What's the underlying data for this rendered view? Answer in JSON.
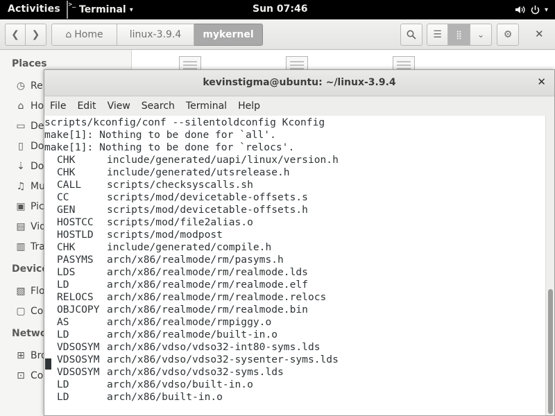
{
  "topbar": {
    "activities": "Activities",
    "app_icon_glyph": ">_",
    "app_name": "Terminal",
    "clock": "Sun 07:46",
    "volume_icon": "speaker-icon",
    "power_icon": "power-icon"
  },
  "file_manager": {
    "back_icon": "back-icon",
    "forward_icon": "forward-icon",
    "path": [
      {
        "label": "Home",
        "icon": "home-icon"
      },
      {
        "label": "linux-3.9.4"
      },
      {
        "label": "mykernel"
      }
    ],
    "search_icon": "search-icon",
    "list_view_icon": "list-view-icon",
    "grid_view_icon": "grid-view-icon",
    "view_options_icon": "chevron-down-icon",
    "settings_icon": "gear-icon",
    "close_icon": "close-icon",
    "sidebar": {
      "places_header": "Places",
      "places": [
        {
          "label": "Re",
          "icon": "recent-icon"
        },
        {
          "label": "Ho",
          "icon": "home-icon"
        },
        {
          "label": "De",
          "icon": "desktop-icon"
        },
        {
          "label": "Do",
          "icon": "documents-icon"
        },
        {
          "label": "Do",
          "icon": "downloads-icon"
        },
        {
          "label": "Mu",
          "icon": "music-icon"
        },
        {
          "label": "Pic",
          "icon": "pictures-icon"
        },
        {
          "label": "Vid",
          "icon": "videos-icon"
        },
        {
          "label": "Tra",
          "icon": "trash-icon"
        }
      ],
      "devices_header": "Device",
      "devices": [
        {
          "label": "Flo",
          "icon": "floppy-icon"
        },
        {
          "label": "Co",
          "icon": "computer-icon"
        }
      ],
      "network_header": "Netwo",
      "network": [
        {
          "label": "Bro",
          "icon": "network-icon"
        },
        {
          "label": "Co",
          "icon": "connect-icon"
        }
      ]
    }
  },
  "terminal": {
    "title": "kevinstigma@ubuntu: ~/linux-3.9.4",
    "close_icon": "close-icon",
    "menu": [
      "File",
      "Edit",
      "View",
      "Search",
      "Terminal",
      "Help"
    ],
    "plain_lines": [
      "scripts/kconfig/conf --silentoldconfig Kconfig",
      "make[1]: Nothing to be done for `all'.",
      "make[1]: Nothing to be done for `relocs'."
    ],
    "build_lines": [
      {
        "tag": "CHK",
        "path": "include/generated/uapi/linux/version.h"
      },
      {
        "tag": "CHK",
        "path": "include/generated/utsrelease.h"
      },
      {
        "tag": "CALL",
        "path": "scripts/checksyscalls.sh"
      },
      {
        "tag": "CC",
        "path": "scripts/mod/devicetable-offsets.s"
      },
      {
        "tag": "GEN",
        "path": "scripts/mod/devicetable-offsets.h"
      },
      {
        "tag": "HOSTCC",
        "path": "scripts/mod/file2alias.o"
      },
      {
        "tag": "HOSTLD",
        "path": "scripts/mod/modpost"
      },
      {
        "tag": "CHK",
        "path": "include/generated/compile.h"
      },
      {
        "tag": "PASYMS",
        "path": "arch/x86/realmode/rm/pasyms.h"
      },
      {
        "tag": "LDS",
        "path": "arch/x86/realmode/rm/realmode.lds"
      },
      {
        "tag": "LD",
        "path": "arch/x86/realmode/rm/realmode.elf"
      },
      {
        "tag": "RELOCS",
        "path": "arch/x86/realmode/rm/realmode.relocs"
      },
      {
        "tag": "OBJCOPY",
        "path": "arch/x86/realmode/rm/realmode.bin"
      },
      {
        "tag": "AS",
        "path": "arch/x86/realmode/rmpiggy.o"
      },
      {
        "tag": "LD",
        "path": "arch/x86/realmode/built-in.o"
      },
      {
        "tag": "VDSOSYM",
        "path": "arch/x86/vdso/vdso32-int80-syms.lds"
      },
      {
        "tag": "VDSOSYM",
        "path": "arch/x86/vdso/vdso32-sysenter-syms.lds"
      },
      {
        "tag": "VDSOSYM",
        "path": "arch/x86/vdso/vdso32-syms.lds"
      },
      {
        "tag": "LD",
        "path": "arch/x86/vdso/built-in.o"
      },
      {
        "tag": "LD",
        "path": "arch/x86/built-in.o"
      }
    ]
  }
}
